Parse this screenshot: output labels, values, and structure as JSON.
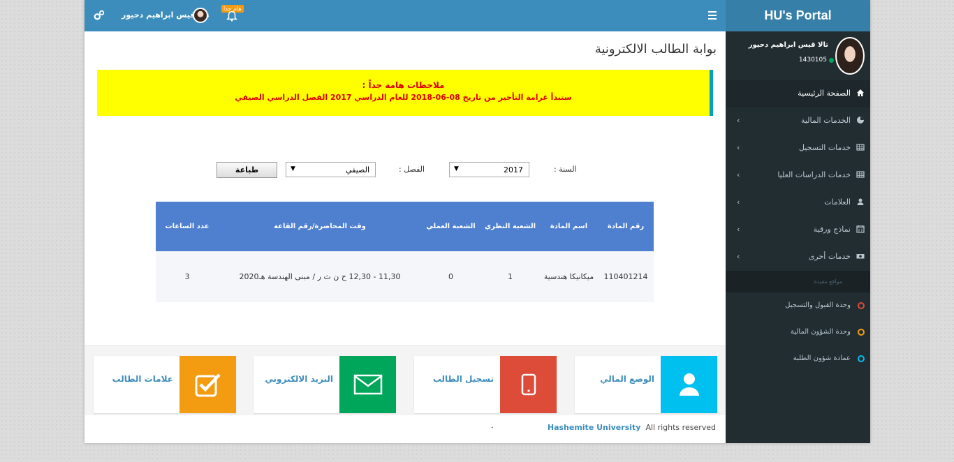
{
  "header": {
    "username": "تالا قيس ابراهيم دحيور",
    "badge": "هام جدا"
  },
  "sidebar": {
    "brand": "HU's Portal",
    "user_name": "تالا قيس ابراهيم دحيور",
    "user_id": "1430105",
    "items": [
      {
        "label": "الصفحة الرئيسية",
        "icon": "home-icon"
      },
      {
        "label": "الخدمات المالية",
        "icon": "pie-chart-icon"
      },
      {
        "label": "خدمات التسجيل",
        "icon": "table-icon"
      },
      {
        "label": "خدمات الدراسات العليا",
        "icon": "table-icon"
      },
      {
        "label": "العلامات",
        "icon": "user-icon"
      },
      {
        "label": "نماذج ورقية",
        "icon": "calendar-icon"
      },
      {
        "label": "خدمات أخرى",
        "icon": "money-icon"
      }
    ],
    "links_header": "مواقع مفيدة",
    "links": [
      {
        "label": "وحدة القبول والتسجيل",
        "color": "#dd4b39"
      },
      {
        "label": "وحدة الشؤون المالية",
        "color": "#f39c12"
      },
      {
        "label": "عمادة شؤون الطلبة",
        "color": "#00c0ef"
      }
    ]
  },
  "main": {
    "title": "بوابة الطالب الالكترونية",
    "notice_title": "ملاحظات هامة جداً :",
    "notice_text": "ستبدأ غرامة التأخير من تاريخ 08-06-2018 للعام الدراسي 2017 الفصل الدراسي الصيفي",
    "year_label": "السنة :",
    "year_value": "2017",
    "semester_label": "الفصل :",
    "semester_value": "الصيفي",
    "print_label": "طباعة"
  },
  "table": {
    "headers": [
      "رقم المادة",
      "اسم المادة",
      "الشعبة النظري",
      "الشعبة العملي",
      "وقت المحاضرة/رقم القاعة",
      "عدد الساعات"
    ],
    "rows": [
      [
        "110401214",
        "ميكانيكا هندسية",
        "1",
        "0",
        "11,30 - 12,30 ح ن ث ر / مبنى الهندسة هـ2020",
        "3"
      ]
    ]
  },
  "tiles": [
    {
      "label": "الوضع المالي",
      "color": "#00c0ef",
      "icon": "user-icon"
    },
    {
      "label": "تسجيل الطالب",
      "color": "#dd4b39",
      "icon": "mobile-icon"
    },
    {
      "label": "البريد الالكتروني",
      "color": "#00a65a",
      "icon": "envelope-icon"
    },
    {
      "label": "علامات الطالب",
      "color": "#f39c12",
      "icon": "checkbox-icon"
    }
  ],
  "footer": {
    "brand": "Hashemite University",
    "rights": "All rights reserved",
    "dot": "."
  }
}
